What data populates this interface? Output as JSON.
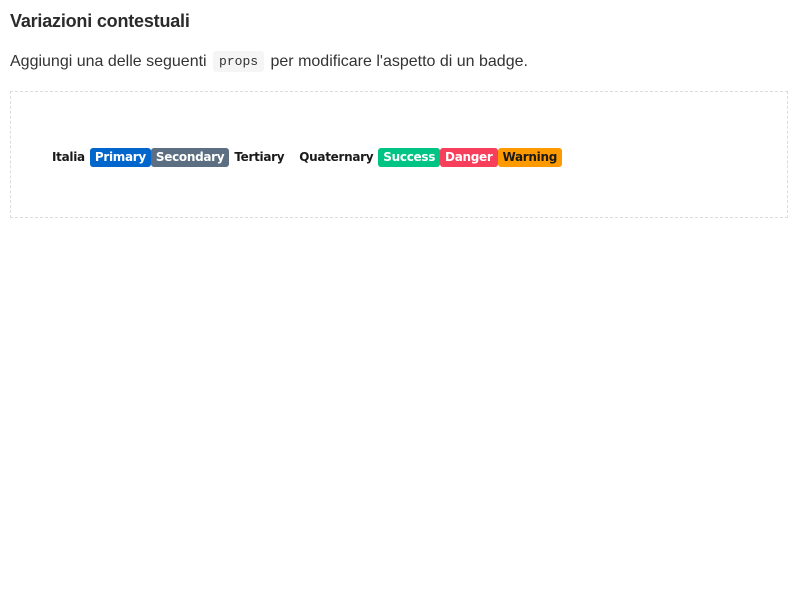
{
  "section": {
    "title": "Variazioni contestuali",
    "intro_before": "Aggiungi una delle seguenti ",
    "intro_code": "props",
    "intro_after": " per modificare l'aspetto di un badge."
  },
  "badges": [
    {
      "label": "Italia",
      "variant": "italia",
      "background": "transparent",
      "color": "#1a1a1a"
    },
    {
      "label": "Primary",
      "variant": "primary",
      "background": "#0066cc",
      "color": "#ffffff"
    },
    {
      "label": "Secondary",
      "variant": "secondary",
      "background": "#5c6f82",
      "color": "#ffffff"
    },
    {
      "label": "Tertiary",
      "variant": "tertiary",
      "background": "transparent",
      "color": "#1a1a1a"
    },
    {
      "label": "Quaternary",
      "variant": "quaternary",
      "background": "transparent",
      "color": "#1a1a1a"
    },
    {
      "label": "Success",
      "variant": "success",
      "background": "#00c483",
      "color": "#ffffff"
    },
    {
      "label": "Danger",
      "variant": "danger",
      "background": "#f73e5a",
      "color": "#ffffff"
    },
    {
      "label": "Warning",
      "variant": "warning",
      "background": "#ff9900",
      "color": "#1a1a1a"
    }
  ]
}
